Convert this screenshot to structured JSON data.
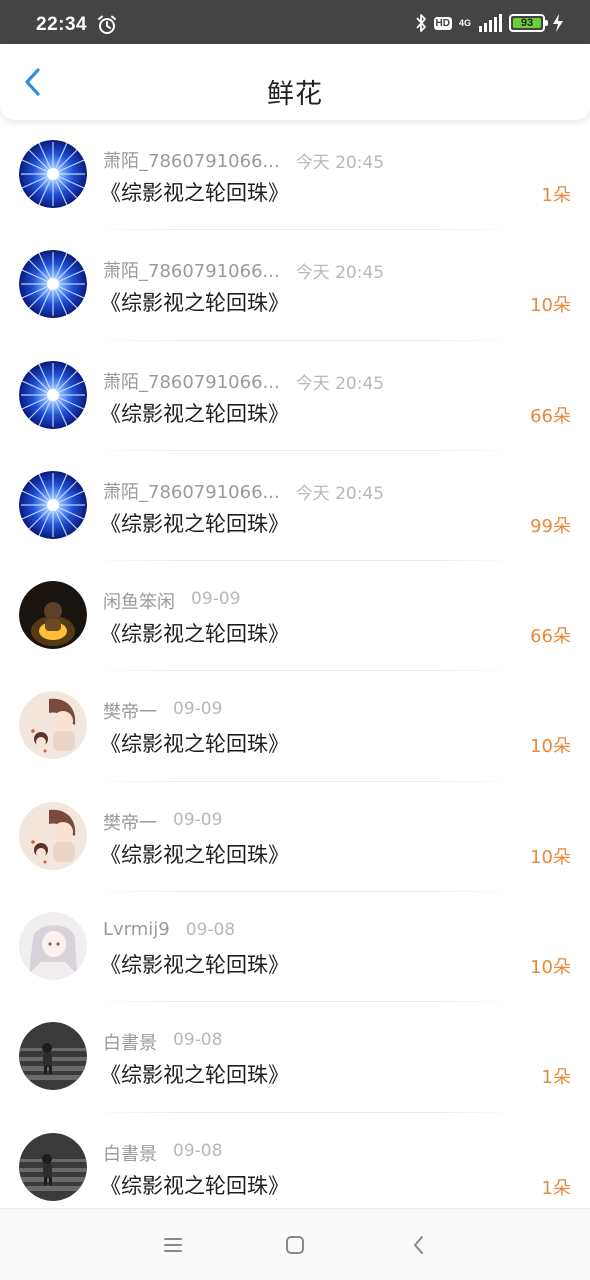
{
  "status_bar": {
    "time": "22:34",
    "network": "4G",
    "hd": "HD",
    "battery": "93"
  },
  "header": {
    "title": "鲜花"
  },
  "items": [
    {
      "name": "萧陌_7860791066...",
      "time": "今天 20:45",
      "book": "《综影视之轮回珠》",
      "count": "1朵",
      "avatar": "blue-star"
    },
    {
      "name": "萧陌_7860791066...",
      "time": "今天 20:45",
      "book": "《综影视之轮回珠》",
      "count": "10朵",
      "avatar": "blue-star"
    },
    {
      "name": "萧陌_7860791066...",
      "time": "今天 20:45",
      "book": "《综影视之轮回珠》",
      "count": "66朵",
      "avatar": "blue-star"
    },
    {
      "name": "萧陌_7860791066...",
      "time": "今天 20:45",
      "book": "《综影视之轮回珠》",
      "count": "99朵",
      "avatar": "blue-star"
    },
    {
      "name": "闲鱼笨闲",
      "time": "09-09",
      "book": "《综影视之轮回珠》",
      "count": "66朵",
      "avatar": "glow-child"
    },
    {
      "name": "樊帝一",
      "time": "09-09",
      "book": "《综影视之轮回珠》",
      "count": "10朵",
      "avatar": "anime-pair"
    },
    {
      "name": "樊帝一",
      "time": "09-09",
      "book": "《综影视之轮回珠》",
      "count": "10朵",
      "avatar": "anime-pair"
    },
    {
      "name": "Lvrmij9",
      "time": "09-08",
      "book": "《综影视之轮回珠》",
      "count": "10朵",
      "avatar": "anime-girl"
    },
    {
      "name": "白書景",
      "time": "09-08",
      "book": "《综影视之轮回珠》",
      "count": "1朵",
      "avatar": "stairs"
    },
    {
      "name": "白書景",
      "time": "09-08",
      "book": "《综影视之轮回珠》",
      "count": "1朵",
      "avatar": "stairs"
    }
  ],
  "colors": {
    "accent_blue": "#2f8fe0",
    "count_orange": "#e8893a",
    "status_bar_bg": "#444444"
  },
  "icons": {
    "back": "back-arrow-icon",
    "alarm": "alarm-icon",
    "bluetooth": "bluetooth-icon",
    "signal": "signal-icon",
    "charging": "charging-icon",
    "nav_menu": "menu-icon",
    "nav_home": "home-icon",
    "nav_back": "nav-back-icon"
  }
}
